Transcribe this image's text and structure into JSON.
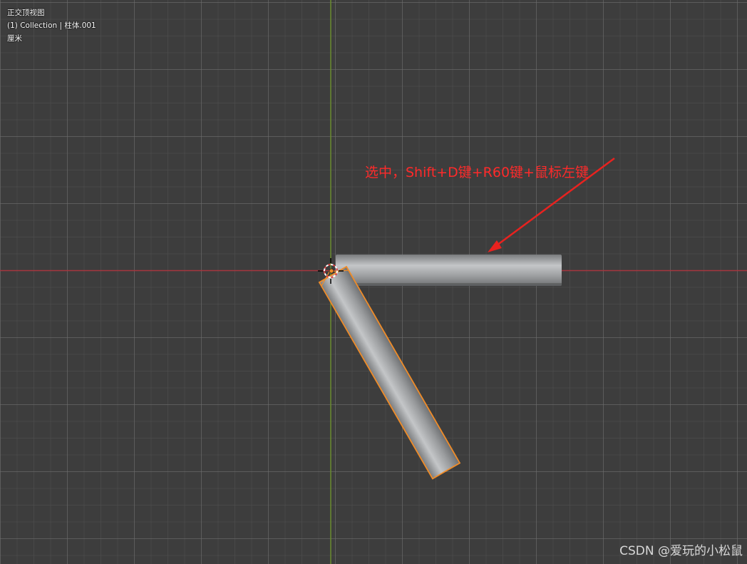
{
  "overlay": {
    "view_name": "正交顶视图",
    "collection_line": "(1) Collection | 柱体.001",
    "unit": "厘米"
  },
  "annotation": {
    "text": "选中，Shift+D键+R60键+鼠标左键",
    "color": "#ff2a2a"
  },
  "watermark": "CSDN @爱玩的小松鼠",
  "colors": {
    "x_axis": "#a5363e",
    "y_axis": "#6b8c2e",
    "selection_outline": "#f08c28",
    "cylinder_gray": "#9a9c9e",
    "background": "#3d3d3d"
  },
  "icons": [
    "3d-cursor-icon",
    "origin-point-icon",
    "arrow-icon"
  ]
}
